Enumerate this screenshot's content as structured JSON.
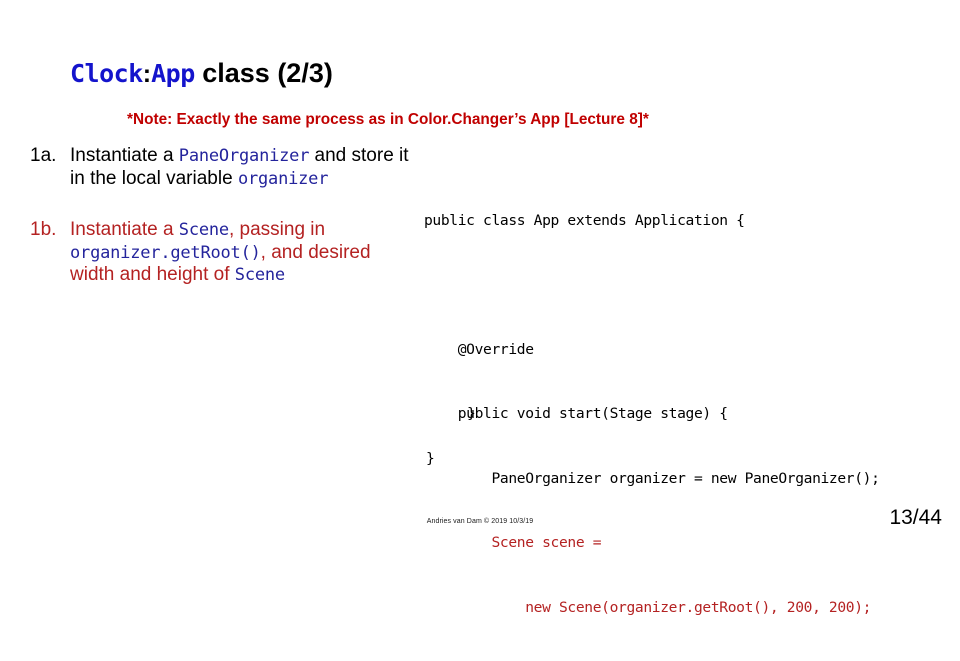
{
  "slide": {
    "title": {
      "code_class": "Clock",
      "separator": ":",
      "code_app": "App",
      "rest": " class (2/3)"
    },
    "note": "*Note: Exactly the same process as in Color.Changer’s App [Lecture 8]*",
    "bullets": [
      {
        "marker": "1a.",
        "segments": [
          {
            "text": "Instantiate a ",
            "style": "plain"
          },
          {
            "text": "PaneOrganizer",
            "style": "code"
          },
          {
            "text": " and store it in the local variable ",
            "style": "plain"
          },
          {
            "text": "organizer",
            "style": "code"
          }
        ]
      },
      {
        "marker": "1b.",
        "segments": [
          {
            "text": "Instantiate a ",
            "style": "plain"
          },
          {
            "text": "Scene",
            "style": "code"
          },
          {
            "text": ", passing in ",
            "style": "plain"
          },
          {
            "text": "organizer.getRoot()",
            "style": "code"
          },
          {
            "text": ", and desired width and height of ",
            "style": "plain"
          },
          {
            "text": "Scene",
            "style": "code"
          }
        ]
      }
    ],
    "code_block": [
      {
        "text": "public class App extends Application {",
        "color": "black"
      },
      {
        "text": "",
        "color": "black"
      },
      {
        "text": "    @Override",
        "color": "black"
      },
      {
        "text": "    public void start(Stage stage) {",
        "color": "black"
      },
      {
        "text": "        PaneOrganizer organizer = new PaneOrganizer();",
        "color": "black"
      },
      {
        "text": "        Scene scene =",
        "color": "red"
      },
      {
        "text": "            new Scene(organizer.getRoot(), 200, 200);",
        "color": "red"
      }
    ],
    "closing_brace_inner": "}",
    "closing_brace_outer": "}",
    "footer_credit": "Andries van Dam © 2019 10/3/19",
    "page_number": "13/44"
  },
  "colors": {
    "code_blue": "#1414CC",
    "inline_code_blue": "#24249C",
    "note_red": "#C00000",
    "body_red": "#B42222",
    "black": "#000000",
    "background": "#FFFFFF"
  }
}
